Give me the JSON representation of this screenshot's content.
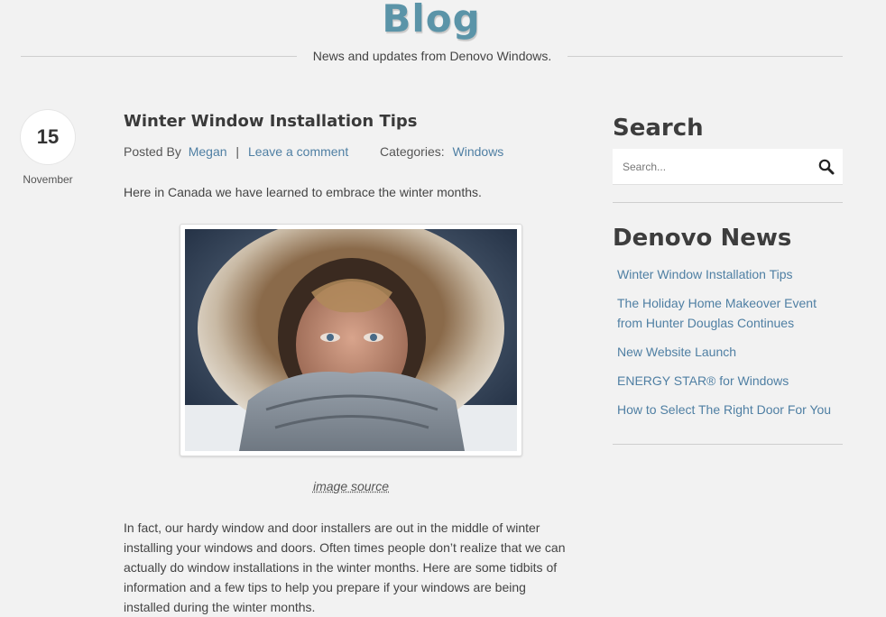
{
  "header": {
    "title": "Blog",
    "tagline": "News and updates from Denovo Windows."
  },
  "post": {
    "day": "15",
    "month": "November",
    "title": "Winter Window Installation Tips",
    "posted_by_label": "Posted By",
    "author": "Megan",
    "separator": "|",
    "comment_link": "Leave a comment",
    "categories_label": "Categories:",
    "category": "Windows",
    "intro": "Here in Canada we have learned to embrace the winter months.",
    "image_source_link": "image source",
    "paragraph": "In fact, our hardy window and door installers are out in the middle of winter installing your windows and doors. Often times people don’t realize that we can actually do window installations in the winter months. Here are some tidbits of information and a few tips to help you prepare if your windows are being installed during the winter months."
  },
  "sidebar": {
    "search_heading": "Search",
    "search_placeholder": "Search...",
    "search_icon": "magnifier-icon",
    "news_heading": "Denovo News",
    "news_items": [
      {
        "label": "Winter Window Installation Tips"
      },
      {
        "label": "The Holiday Home Makeover Event from Hunter Douglas Continues"
      },
      {
        "label": "New Website Launch"
      },
      {
        "label": "ENERGY STAR® for Windows"
      },
      {
        "label": "How to Select The Right Door For You"
      }
    ]
  },
  "colors": {
    "accent": "#5b94a8",
    "link": "#4f7fa3",
    "background": "#f2f2f2"
  }
}
